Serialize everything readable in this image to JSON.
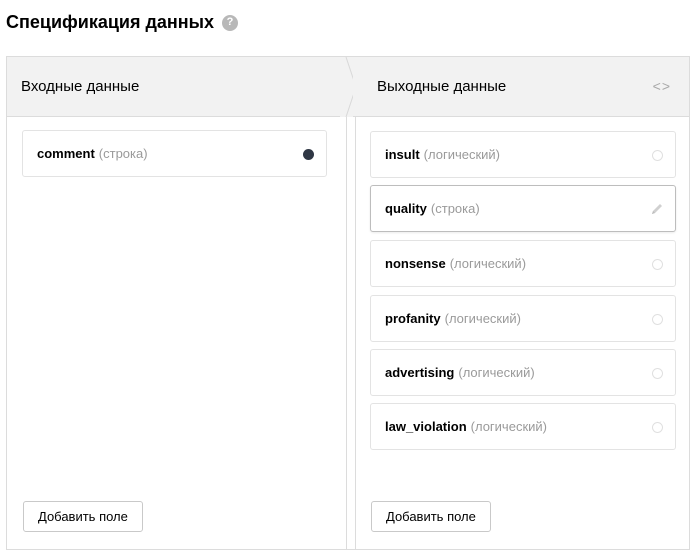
{
  "title": "Спецификация данных",
  "help_icon_glyph": "?",
  "input": {
    "header": "Входные данные",
    "fields": [
      {
        "name": "comment",
        "type": "(строка)",
        "marker": "filled-dot"
      }
    ],
    "add_button": "Добавить поле"
  },
  "output": {
    "header": "Выходные данные",
    "code_toggle": "<>",
    "fields": [
      {
        "name": "insult",
        "type": "(логический)",
        "marker": "empty-dot"
      },
      {
        "name": "quality",
        "type": "(строка)",
        "marker": "pencil-icon"
      },
      {
        "name": "nonsense",
        "type": "(логический)",
        "marker": "empty-dot"
      },
      {
        "name": "profanity",
        "type": "(логический)",
        "marker": "empty-dot"
      },
      {
        "name": "advertising",
        "type": "(логический)",
        "marker": "empty-dot"
      },
      {
        "name": "law_violation",
        "type": "(логический)",
        "marker": "empty-dot"
      }
    ],
    "add_button": "Добавить поле"
  },
  "colors": {
    "header_bg": "#f2f2f2",
    "border": "#dcdcdc",
    "type_text": "#9a9a9a",
    "filled_dot": "#2f3744"
  }
}
